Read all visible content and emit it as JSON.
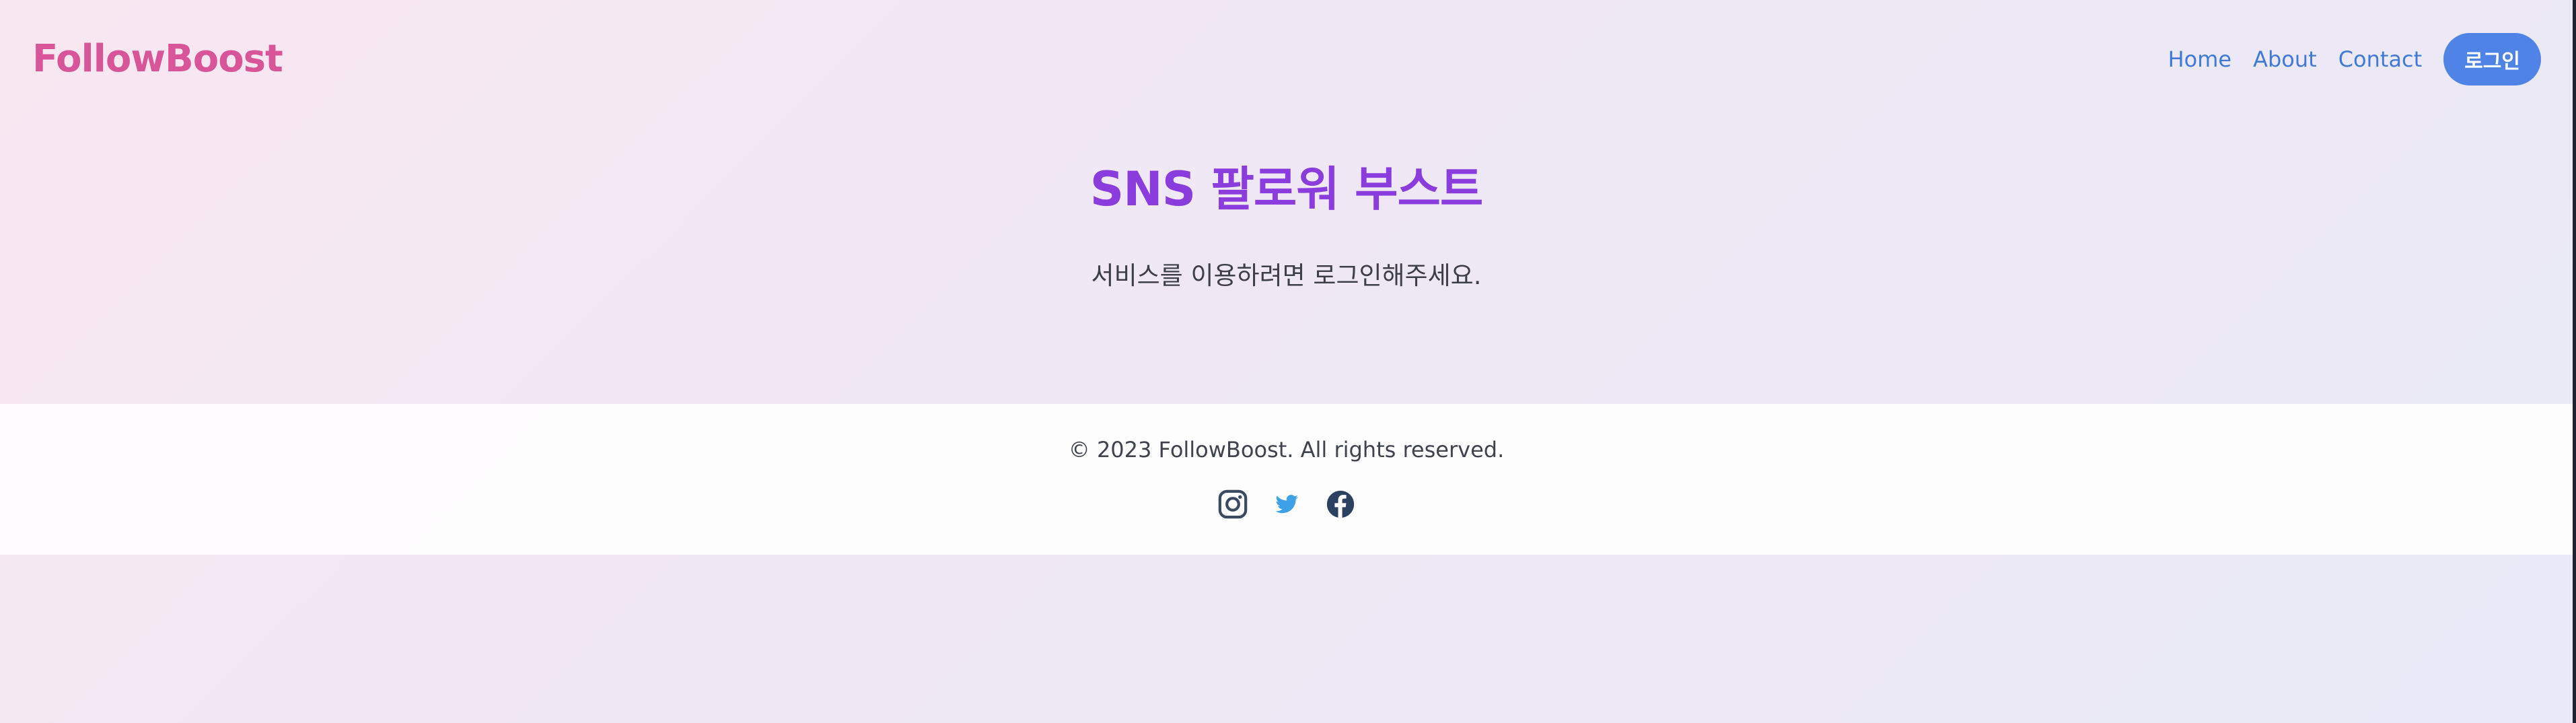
{
  "header": {
    "brand": "FollowBoost",
    "nav": [
      {
        "label": "Home"
      },
      {
        "label": "About"
      },
      {
        "label": "Contact"
      }
    ],
    "login_label": "로그인"
  },
  "hero": {
    "title": "SNS 팔로워 부스트",
    "subtitle": "서비스를 이용하려면 로그인해주세요."
  },
  "footer": {
    "copyright": "© 2023 FollowBoost. All rights reserved.",
    "socials": [
      {
        "icon": "instagram-icon",
        "color": "#3b4a5e"
      },
      {
        "icon": "twitter-icon",
        "color": "#3ea0e6"
      },
      {
        "icon": "facebook-icon",
        "color": "#2c4060"
      }
    ]
  },
  "colors": {
    "brand": "#d9559a",
    "title": "#8a3cdc",
    "link": "#3f7ad6",
    "button": "#4f83e6"
  }
}
